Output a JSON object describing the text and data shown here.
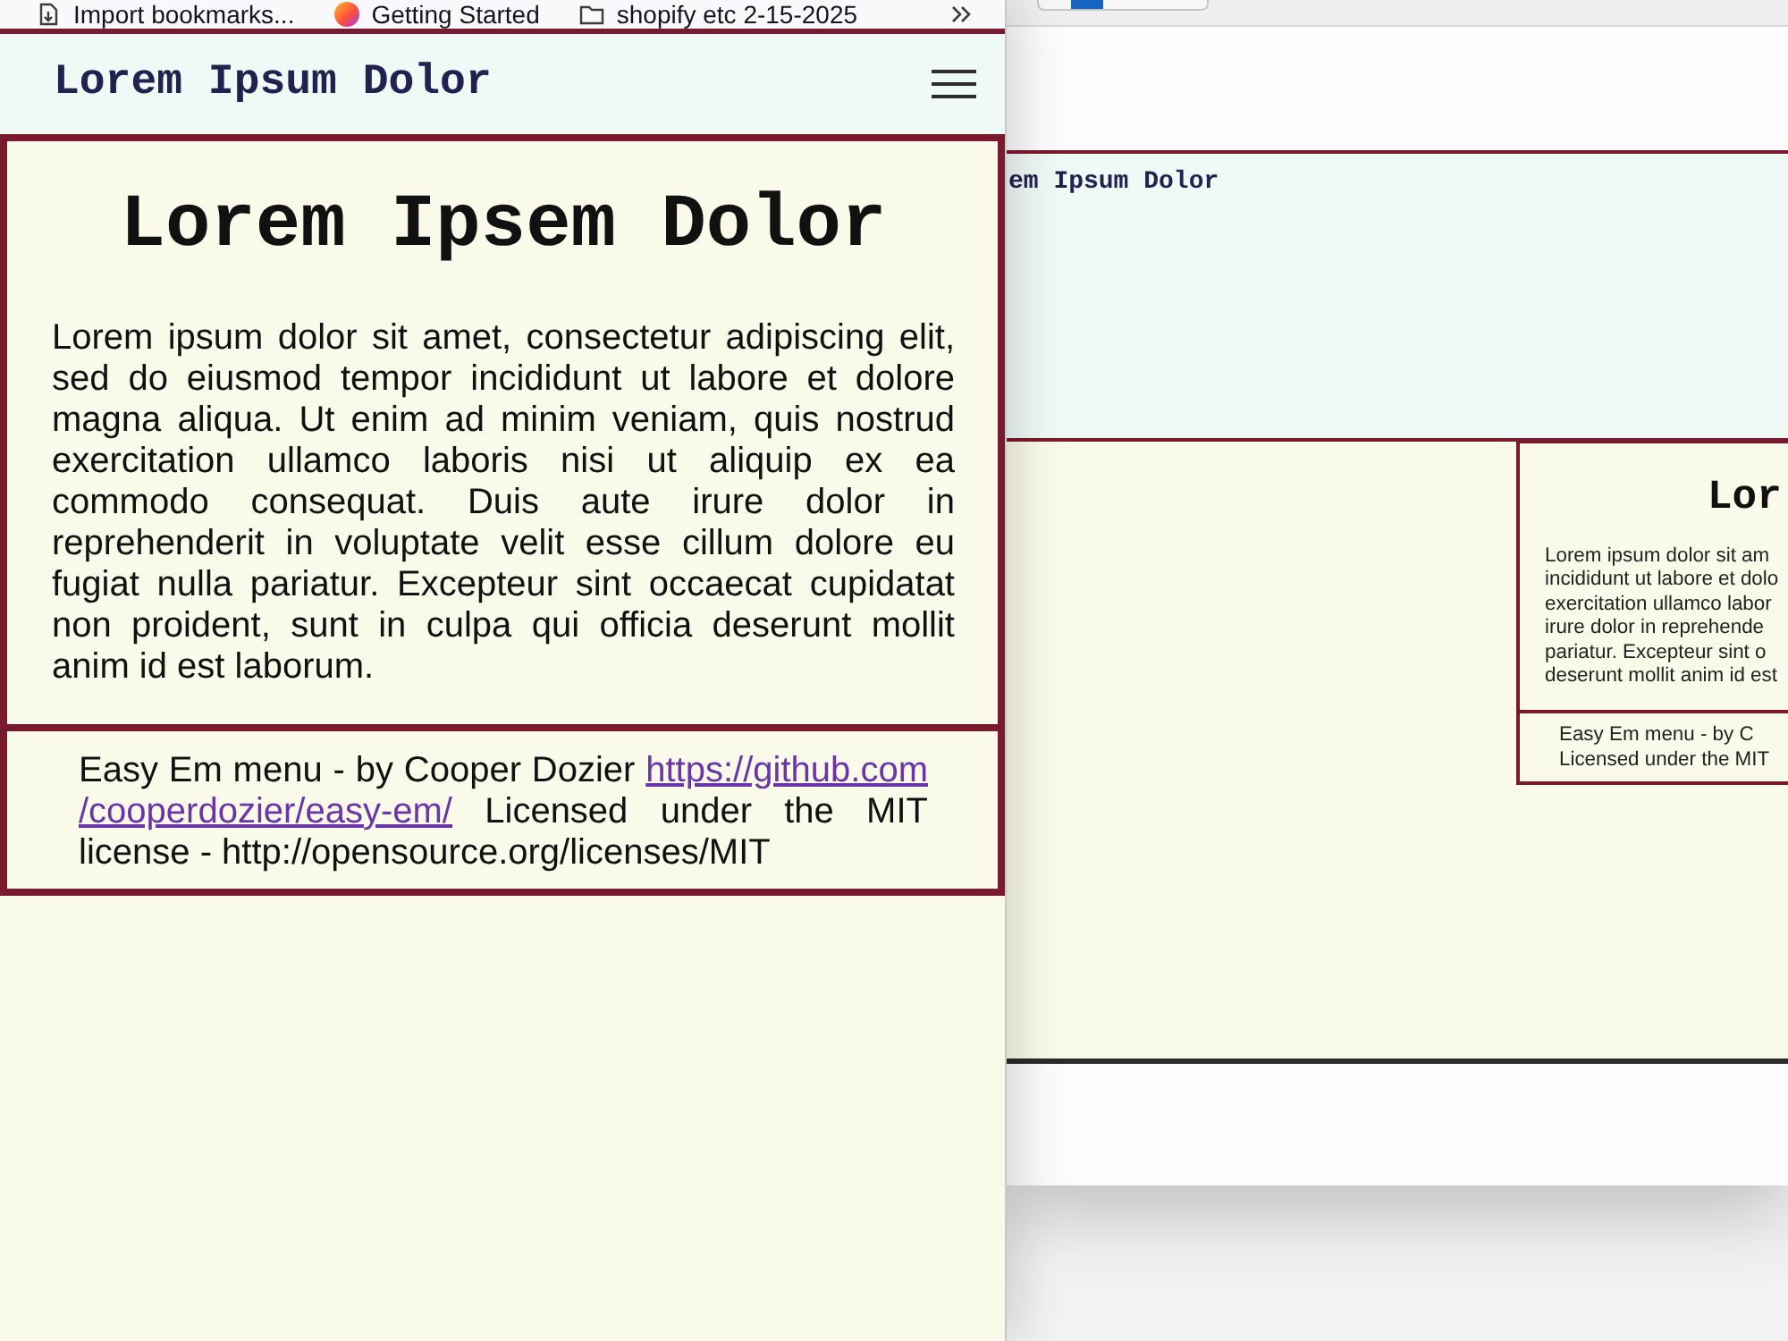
{
  "bookmarks_bar": {
    "items": [
      {
        "label": "Import bookmarks...",
        "kind": "import"
      },
      {
        "label": "Getting Started",
        "kind": "logo"
      },
      {
        "label": "shopify etc 2-15-2025",
        "kind": "folder"
      }
    ]
  },
  "front_window": {
    "header": {
      "title": "Lorem Ipsum Dolor"
    },
    "article": {
      "heading": "Lorem Ipsem Dolor",
      "paragraph": "Lorem ipsum dolor sit amet, consectetur adipiscing elit, sed do eiusmod tempor incididunt ut labore et dolore magna aliqua. Ut enim ad minim veniam, quis nostrud exercitation ullamco laboris nisi ut aliquip ex ea commodo consequat. Duis aute irure dolor in reprehenderit in voluptate velit esse cillum dolore eu fugiat nulla pariatur. Excepteur sint occaecat cupidatat non proident, sunt in culpa qui officia deserunt mollit anim id est laborum."
    },
    "footer": {
      "text_before": "Easy Em menu - by Cooper Dozier",
      "link_parts": [
        "https://github.com",
        "/cooperdozier/easy-em/"
      ],
      "text_after": "Licensed under the MIT license - http://opensource.org/licenses/MIT"
    }
  },
  "back_window": {
    "header": {
      "title": "em Ipsum Dolor"
    },
    "article": {
      "heading": "Lor",
      "paragraph_lines": [
        "Lorem ipsum dolor sit am",
        "incididunt ut labore et dolo",
        "exercitation ullamco labor",
        "irure dolor in reprehende",
        "pariatur. Excepteur sint o",
        "deserunt mollit anim id est"
      ]
    },
    "footer": {
      "lines": [
        "Easy Em menu - by C",
        "Licensed under the MIT"
      ]
    }
  }
}
